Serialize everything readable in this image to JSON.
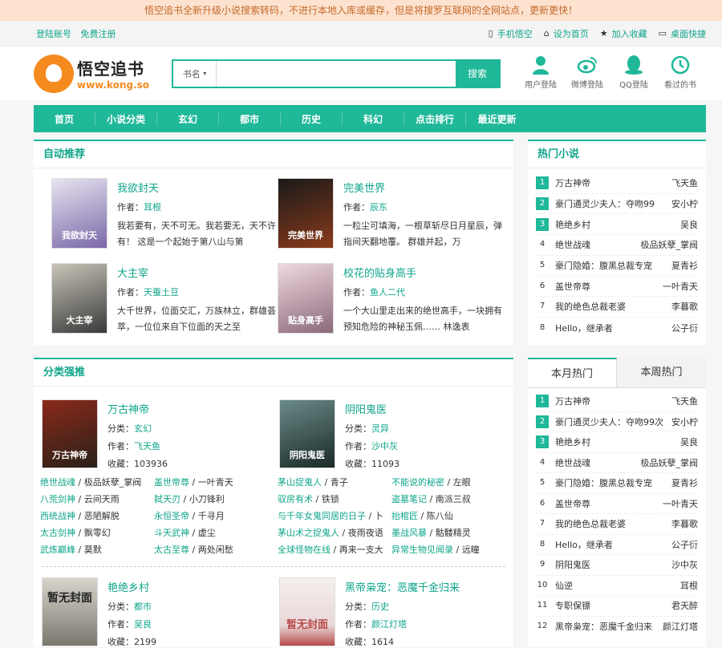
{
  "notice": "悟空追书全新升级小说搜索转码，不进行本地入库或缓存，但是将搜罗互联网的全网站点，更新更快！",
  "topbar": {
    "login": "登陆账号",
    "register": "免费注册",
    "mobile": "手机悟空",
    "homepage": "设为首页",
    "favorite": "加入收藏",
    "desktop": "桌面快捷"
  },
  "logo": {
    "title": "悟空追书",
    "url": "www.kong.so"
  },
  "search": {
    "select": "书名",
    "placeholder": "",
    "button": "搜索"
  },
  "userlinks": [
    "用户登陆",
    "微博登陆",
    "QQ登陆",
    "看过的书"
  ],
  "nav": [
    "首页",
    "小说分类",
    "玄幻",
    "都市",
    "历史",
    "科幻",
    "点击排行",
    "最近更新"
  ],
  "auto": {
    "title": "自动推荐",
    "author_label": "作者：",
    "books": [
      {
        "title": "我欲封天",
        "author": "耳根",
        "cover_text": "我欲封天",
        "desc": "我若要有，天不可无。我若要无，天不许有！ 这是一个起始于第八山与第",
        "c1": "#7a68a8",
        "c2": "#e8e4f0"
      },
      {
        "title": "完美世界",
        "author": "辰东",
        "cover_text": "完美世界",
        "desc": "一粒尘可填海，一根草斩尽日月星辰，弹指间天翻地覆。 群雄并起，万",
        "c1": "#1a1a1a",
        "c2": "#8a3a1a"
      },
      {
        "title": "大主宰",
        "author": "天蚕土豆",
        "cover_text": "大主宰",
        "desc": "大千世界，位面交汇，万族林立，群雄荟萃，一位位来自下位面的天之至",
        "c1": "#3a3a3a",
        "c2": "#c8c4b8"
      },
      {
        "title": "校花的贴身高手",
        "author": "鱼人二代",
        "cover_text": "贴身高手",
        "desc": "一个大山里走出来的绝世高手，一块拥有预知危险的神秘玉佩…… 林逸表",
        "c1": "#f0d8e0",
        "c2": "#8a6a7a"
      }
    ]
  },
  "cat": {
    "title": "分类强推",
    "cat_label": "分类：",
    "author_label": "作者：",
    "views_label": "收藏：",
    "books": [
      {
        "title": "万古神帝",
        "cat": "玄幻",
        "author": "飞天鱼",
        "views": "103936",
        "cover_text": "万古神帝",
        "c1": "#2a2018",
        "c2": "#8a2a1a"
      },
      {
        "title": "阴阳鬼医",
        "cat": "灵异",
        "author": "沙中灰",
        "views": "11093",
        "cover_text": "阴阳鬼医",
        "c1": "#1a2a28",
        "c2": "#6a8a88"
      },
      {
        "title": "艳绝乡村",
        "cat": "都市",
        "author": "吴良",
        "views": "2199",
        "cover_text": "暂无封面",
        "c1": "#d8d4cc",
        "c2": "#7a786e"
      },
      {
        "title": "黑帝枭宠：恶魔千金归来",
        "cat": "历史",
        "author": "颜江灯塔",
        "views": "1614",
        "cover_text": "暂无封面",
        "c1": "#f4f0ec",
        "c2": "#b84a4a"
      }
    ],
    "links_left": [
      [
        [
          "绝世战魂",
          "极品妖孽_掌阀"
        ],
        [
          "盖世帝尊",
          "一叶青天"
        ]
      ],
      [
        [
          "八荒剑神",
          "云间天雨"
        ],
        [
          "弑天刃",
          "小刀锋利"
        ]
      ],
      [
        [
          "西统战神",
          "恶陋解脱"
        ],
        [
          "永恒圣帝",
          "千寻月"
        ]
      ],
      [
        [
          "太古剑神",
          "飘零幻"
        ],
        [
          "斗天武神",
          "虚尘"
        ]
      ],
      [
        [
          "武炼巅峰",
          "莫默"
        ],
        [
          "太古至尊",
          "两处闲愁"
        ]
      ]
    ],
    "links_right": [
      [
        [
          "茅山捉鬼人",
          "青子"
        ],
        [
          "不能说的秘密",
          "左眼"
        ]
      ],
      [
        [
          "驭房有术",
          "铁锁"
        ],
        [
          "盗墓笔记",
          "南派三叔"
        ]
      ],
      [
        [
          "与千年女鬼同居的日子",
          "卜"
        ],
        [
          "抬棺匠",
          "陈八仙"
        ]
      ],
      [
        [
          "茅山术之捉鬼人",
          "夜雨夜语"
        ],
        [
          "墨战风暴",
          "骷髅精灵"
        ]
      ],
      [
        [
          "全球怪物在线",
          "再来一支大"
        ],
        [
          "异常生物见闻录",
          "远瞳"
        ]
      ]
    ]
  },
  "hot": {
    "title": "热门小说",
    "items": [
      [
        "万古神帝",
        "飞天鱼"
      ],
      [
        "豪门通灵少夫人：夺吻99",
        "安小柠"
      ],
      [
        "艳绝乡村",
        "吴良"
      ],
      [
        "绝世战魂",
        "极品妖孽_掌阀"
      ],
      [
        "豪门隐婚：腹黑总裁专宠",
        "夏青衫"
      ],
      [
        "盖世帝尊",
        "一叶青天"
      ],
      [
        "我的绝色总裁老婆",
        "李暮歌"
      ],
      [
        "Hello，继承者",
        "公子衍"
      ]
    ]
  },
  "monthly": {
    "tab_active": "本月热门",
    "tab_inactive": "本周热门",
    "items": [
      [
        "万古神帝",
        "飞天鱼"
      ],
      [
        "豪门通灵少夫人：夺吻99次",
        "安小柠"
      ],
      [
        "艳绝乡村",
        "吴良"
      ],
      [
        "绝世战魂",
        "极品妖孽_掌阀"
      ],
      [
        "豪门隐婚：腹黑总裁专宠",
        "夏青衫"
      ],
      [
        "盖世帝尊",
        "一叶青天"
      ],
      [
        "我的绝色总裁老婆",
        "李暮歌"
      ],
      [
        "Hello，继承者",
        "公子衍"
      ],
      [
        "阴阳鬼医",
        "沙中灰"
      ],
      [
        "仙逆",
        "耳根"
      ],
      [
        "专职保镖",
        "君天醉"
      ],
      [
        "黑帝枭宠：恶魔千金归来",
        "颜江灯塔"
      ]
    ]
  },
  "colors": {
    "accent": "#1fb899",
    "link": "#0fa58a",
    "logo": "#f58a1f"
  }
}
